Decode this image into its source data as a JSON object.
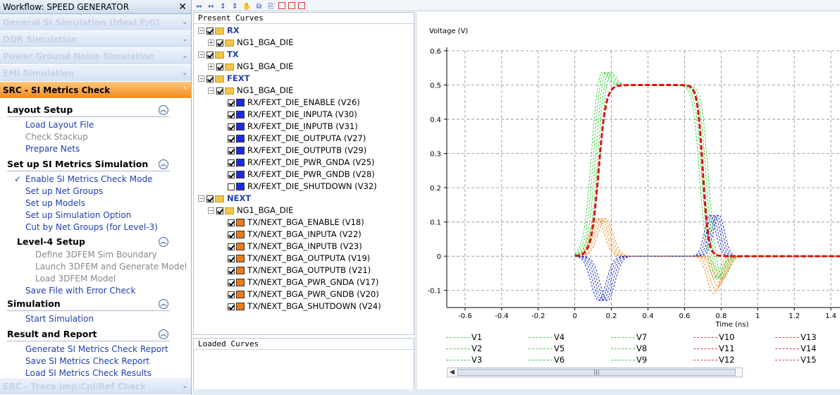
{
  "workflow": {
    "title": "Workflow: SPEED GENERATOR",
    "close": "✕"
  },
  "sections_top": [
    {
      "label": "General SI Simulation (Ideal P/G)"
    },
    {
      "label": "DDR Simulation"
    },
    {
      "label": "Power Ground Noise Simulation"
    },
    {
      "label": "EMI Simulation"
    }
  ],
  "active_section": {
    "label": "SRC - SI Metrics Check"
  },
  "layout_setup": {
    "title": "Layout Setup",
    "items": [
      "Load Layout File",
      "Check Stackup",
      "Prepare Nets"
    ]
  },
  "si_setup": {
    "title": "Set up SI Metrics Simulation",
    "items": [
      "Enable SI Metrics Check Mode",
      "Set up Net Groups",
      "Set up Models",
      "Set up Simulation Option",
      "Cut by Net Groups (for Level-3)"
    ]
  },
  "level4": {
    "title": "Level-4 Setup",
    "items": [
      "Define 3DFEM Sim Boundary",
      "Launch 3DFEM and Generate Model",
      "Load 3DFEM Model"
    ],
    "save": "Save File with Error Check"
  },
  "simulation": {
    "title": "Simulation",
    "items": [
      "Start Simulation"
    ]
  },
  "result": {
    "title": "Result and Report",
    "items": [
      "Generate SI Metrics Check Report",
      "Save SI Metrics Check Report",
      "Load SI Metrics Check Results"
    ]
  },
  "erc": {
    "label": "ERC - Trace Imp/Cpl/Ref Check"
  },
  "present_curves": {
    "title": "Present Curves",
    "rx": "RX",
    "rx_die": "NG1_BGA_DIE",
    "tx": "TX",
    "tx_die": "NG1_BGA_DIE",
    "fext": "FEXT",
    "fext_die": "NG1_BGA_DIE",
    "fext_items": [
      "RX/FEXT_DIE_ENABLE (V26)",
      "RX/FEXT_DIE_INPUTA (V30)",
      "RX/FEXT_DIE_INPUTB (V31)",
      "RX/FEXT_DIE_OUTPUTA (V27)",
      "RX/FEXT_DIE_OUTPUTB (V29)",
      "RX/FEXT_DIE_PWR_GNDA (V25)",
      "RX/FEXT_DIE_PWR_GNDB (V28)",
      "RX/FEXT_DIE_SHUTDOWN (V32)"
    ],
    "next": "NEXT",
    "next_die": "NG1_BGA_DIE",
    "next_items": [
      "TX/NEXT_BGA_ENABLE (V18)",
      "TX/NEXT_BGA_INPUTA (V22)",
      "TX/NEXT_BGA_INPUTB (V23)",
      "TX/NEXT_BGA_OUTPUTA (V19)",
      "TX/NEXT_BGA_OUTPUTB (V21)",
      "TX/NEXT_BGA_PWR_GNDA (V17)",
      "TX/NEXT_BGA_PWR_GNDB (V20)",
      "TX/NEXT_BGA_SHUTDOWN (V24)"
    ]
  },
  "loaded_curves": {
    "title": "Loaded Curves"
  },
  "colors": {
    "fext_swatch": "#1a2ae8",
    "next_swatch": "#f07a12",
    "green": "#3fd03f",
    "red": "#e01010",
    "blue": "#2030c8",
    "orange": "#f08a20"
  },
  "chart_data": {
    "type": "line",
    "ylabel": "Voltage (V)",
    "xlabel": "Time (ns)",
    "xlim": [
      -0.7,
      1.45
    ],
    "ylim": [
      -0.15,
      0.6
    ],
    "xticks": [
      "-0.6",
      "-0.4",
      "-0.2",
      "0",
      "0.2",
      "0.4",
      "0.6",
      "0.8",
      "1",
      "1.2",
      "1.4"
    ],
    "yticks": [
      "0.6",
      "0.5",
      "0.4",
      "0.3",
      "0.2",
      "0.1",
      "0",
      "-0.1"
    ],
    "grid": true,
    "legend": [
      "V1",
      "V4",
      "V7",
      "V10",
      "V13",
      "V2",
      "V5",
      "V8",
      "V11",
      "V14",
      "V3",
      "V6",
      "V9",
      "V12",
      "V15"
    ]
  }
}
